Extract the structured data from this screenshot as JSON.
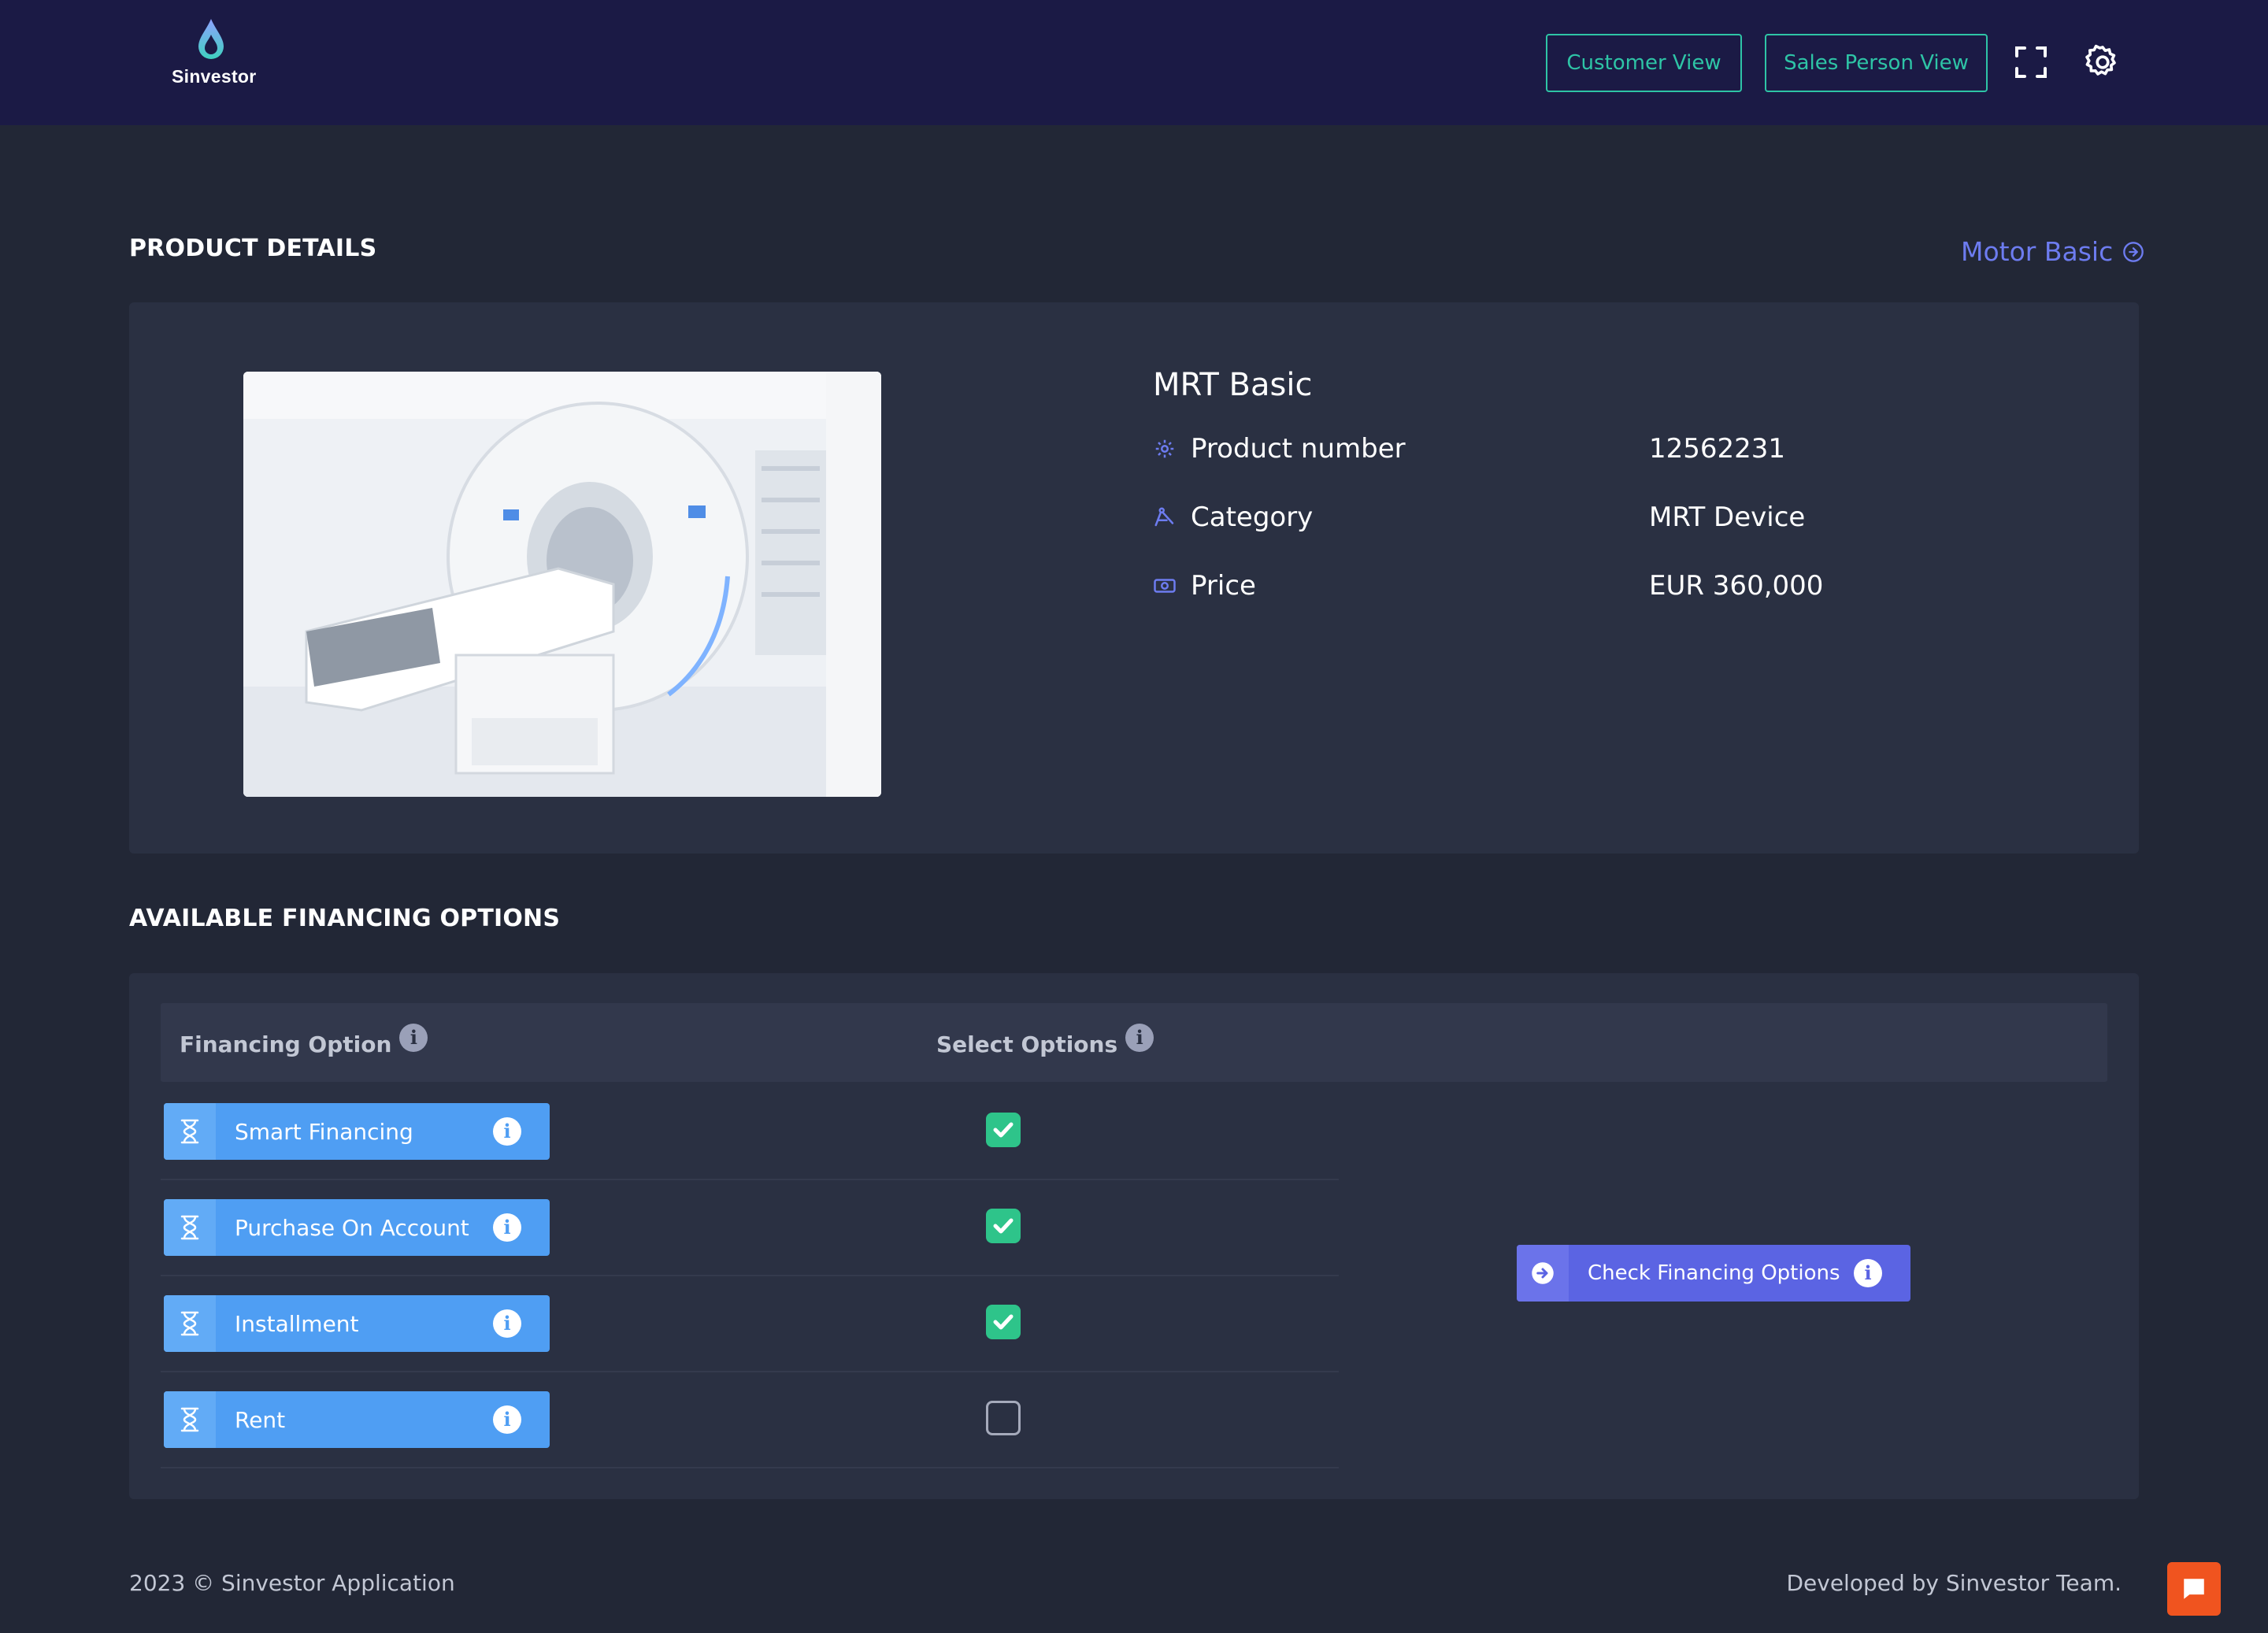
{
  "header": {
    "logo_text": "Sinvestor",
    "customer_view_label": "Customer View",
    "sales_view_label": "Sales Person View",
    "fullscreen_icon": "fullscreen-icon",
    "settings_icon": "gear-icon"
  },
  "product_section": {
    "title": "PRODUCT DETAILS",
    "link_label": "Motor Basic",
    "product_name": "MRT Basic",
    "attributes": [
      {
        "label": "Product number",
        "value": "12562231",
        "icon": "gear-icon"
      },
      {
        "label": "Category",
        "value": "MRT Device",
        "icon": "compass-icon"
      },
      {
        "label": "Price",
        "value": "EUR 360,000",
        "icon": "money-icon"
      }
    ]
  },
  "financing_section": {
    "title": "AVAILABLE FINANCING OPTIONS",
    "col_option": "Financing Option",
    "col_select": "Select Options",
    "options": [
      {
        "label": "Smart Financing",
        "selected": true
      },
      {
        "label": "Purchase On Account",
        "selected": true
      },
      {
        "label": "Installment",
        "selected": true
      },
      {
        "label": "Rent",
        "selected": false
      }
    ],
    "check_button_label": "Check Financing Options"
  },
  "footer": {
    "copyright": "2023 © Sinvestor Application",
    "credit": "Developed by Sinvestor Team."
  },
  "colors": {
    "accent_teal": "#2ec4a6",
    "accent_blue": "#4f9ef3",
    "accent_indigo": "#5b64e3",
    "check_green": "#2ec48a",
    "chat_orange": "#f0541f"
  }
}
